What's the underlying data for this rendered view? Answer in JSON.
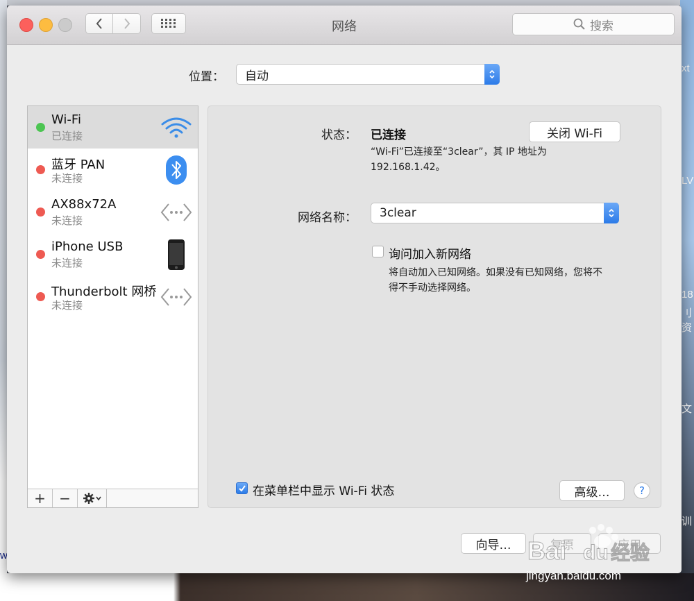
{
  "window": {
    "title": "网络"
  },
  "toolbar": {
    "search_placeholder": "搜索"
  },
  "location": {
    "label": "位置：",
    "value": "自动"
  },
  "services": [
    {
      "name": "Wi-Fi",
      "status": "已连接",
      "state": "connected",
      "icon": "wifi-icon"
    },
    {
      "name": "蓝牙 PAN",
      "status": "未连接",
      "state": "disconnected",
      "icon": "bluetooth-icon"
    },
    {
      "name": "AX88x72A",
      "status": "未连接",
      "state": "disconnected",
      "icon": "ethernet-icon"
    },
    {
      "name": "iPhone USB",
      "status": "未连接",
      "state": "disconnected",
      "icon": "iphone-icon"
    },
    {
      "name": "Thunderbolt 网桥",
      "status": "未连接",
      "state": "disconnected",
      "icon": "ethernet-icon"
    }
  ],
  "sidebar_footer": {
    "add": "+",
    "remove": "−"
  },
  "detail": {
    "status_label": "状态：",
    "status_value": "已连接",
    "wifi_off_button": "关闭 Wi-Fi",
    "status_desc_line1": "“Wi-Fi”已连接至“3clear”，其 IP 地址为",
    "status_desc_line2": "192.168.1.42。",
    "network_name_label": "网络名称：",
    "network_name_value": "3clear",
    "ask_join_label": "询问加入新网络",
    "ask_join_checked": false,
    "ask_join_desc_line1": "将自动加入已知网络。如果没有已知网络，您将不",
    "ask_join_desc_line2": "得不手动选择网络。",
    "show_menubar_label": "在菜单栏中显示 Wi-Fi 状态",
    "show_menubar_checked": true,
    "advanced_button": "高级…",
    "help_button": "?"
  },
  "bottom_buttons": {
    "assist": "向导…",
    "revert": "复原",
    "apply": "应用"
  },
  "desktop": {
    "r1": "xt",
    "r2": "LV",
    "r3": "18",
    "r4": "刂资",
    "r5": "文",
    "r6": "训",
    "left_w": "w"
  },
  "watermark": {
    "logo": "Bai du 经验",
    "url": "jingyan.baidu.com"
  },
  "colors": {
    "accent": "#2c7be8",
    "connected": "#4cc552",
    "disconnected": "#ee5a52"
  }
}
